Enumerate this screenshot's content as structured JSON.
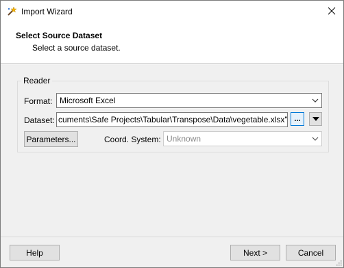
{
  "window": {
    "title": "Import Wizard",
    "app_icon": "wizard-wand-icon",
    "close_icon": "close-icon"
  },
  "header": {
    "title": "Select Source Dataset",
    "subtitle": "Select a source dataset."
  },
  "reader": {
    "group_label": "Reader",
    "format_label": "Format:",
    "format_value": "Microsoft Excel",
    "dataset_label": "Dataset:",
    "dataset_value": "cuments\\Safe Projects\\Tabular\\Transpose\\Data\\vegetable.xlsx\"",
    "browse_label": "...",
    "parameters_label": "Parameters...",
    "coord_label": "Coord. System:",
    "coord_value": "Unknown"
  },
  "footer": {
    "help_label": "Help",
    "next_label": "Next >",
    "cancel_label": "Cancel"
  },
  "colors": {
    "accent": "#0078d7",
    "dialog_bg": "#f0f0f0"
  }
}
